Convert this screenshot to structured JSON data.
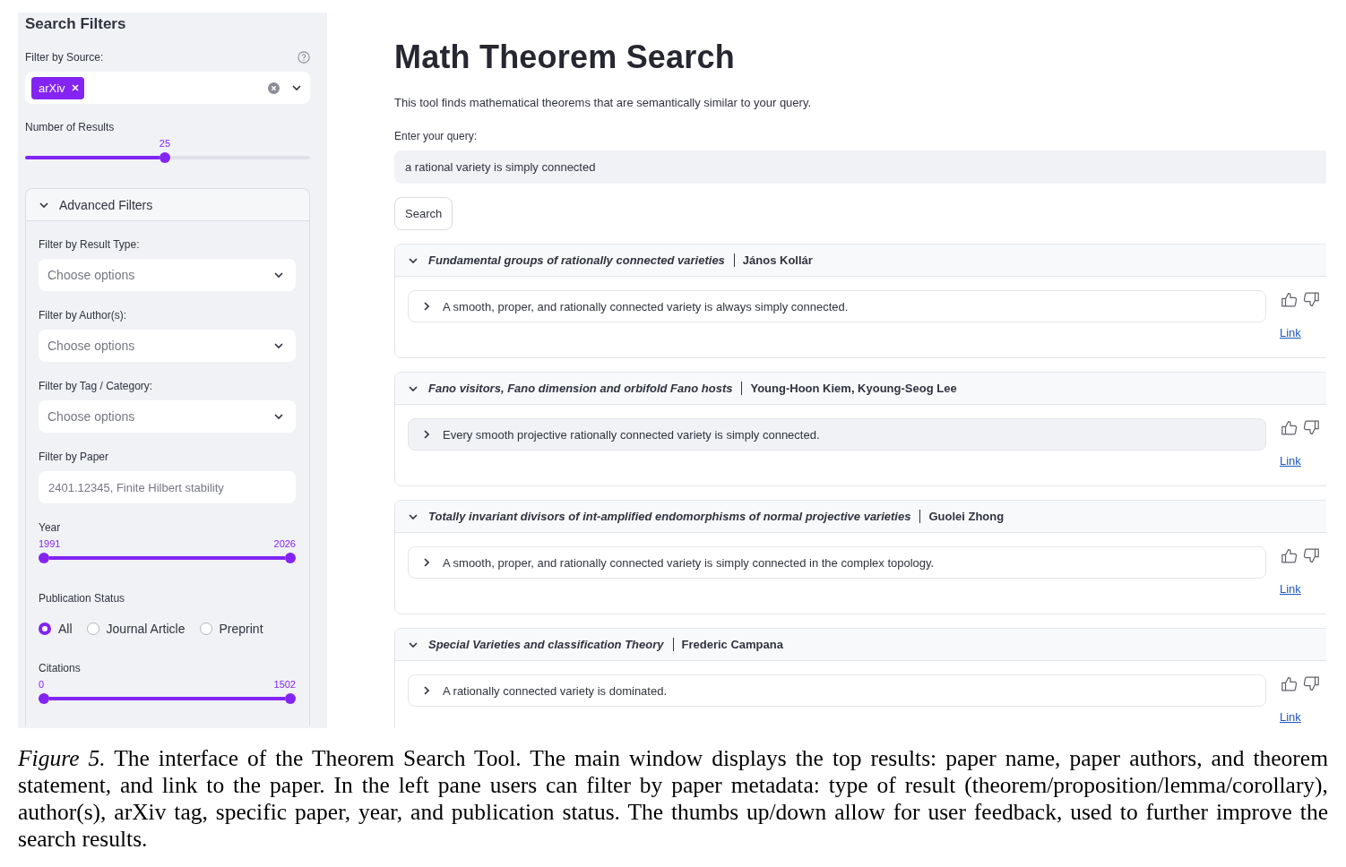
{
  "sidebar": {
    "title": "Search Filters",
    "source_filter": {
      "label": "Filter by Source:",
      "tags": [
        "arXiv"
      ]
    },
    "number_of_results": {
      "label": "Number of Results",
      "value": "25",
      "level": 0.49
    },
    "advanced_filters": {
      "title": "Advanced Filters",
      "expanded": true,
      "selects": [
        {
          "label": "Filter by Result Type:",
          "placeholder": "Choose options"
        },
        {
          "label": "Filter by Author(s):",
          "placeholder": "Choose options"
        },
        {
          "label": "Filter by Tag / Category:",
          "placeholder": "Choose options"
        }
      ],
      "paper_filter": {
        "label": "Filter by Paper",
        "placeholder": "2401.12345, Finite Hilbert stability"
      },
      "year": {
        "label": "Year",
        "low_value": "1991",
        "high_value": "2026",
        "level": 1
      },
      "publication_status": {
        "label": "Publication Status",
        "options": [
          {
            "label": "All",
            "selected": true
          },
          {
            "label": "Journal Article",
            "selected": false
          },
          {
            "label": "Preprint",
            "selected": false
          }
        ]
      },
      "citations": {
        "label": "Citations",
        "low_value": "0",
        "high_value": "1502",
        "level": 1
      }
    }
  },
  "main": {
    "title": "Math Theorem Search",
    "description": "This tool finds mathematical theorems that are semantically similar to your query.",
    "query": {
      "label": "Enter your query:",
      "value": "a rational variety is simply connected"
    },
    "search_button": "Search",
    "results": [
      {
        "paper_title": "Fundamental groups of rationally connected varieties",
        "authors": "János Kollár",
        "expanded": true,
        "statement": {
          "text": "A smooth, proper, and rationally connected variety is always simply connected.",
          "expanded": false,
          "hovered": false
        },
        "link": "Link"
      },
      {
        "paper_title": "Fano visitors, Fano dimension and orbifold Fano hosts",
        "authors": "Young-Hoon Kiem, Kyoung-Seog Lee",
        "expanded": true,
        "statement": {
          "text": "Every smooth projective rationally connected variety is simply connected.",
          "expanded": false,
          "hovered": true
        },
        "link": "Link"
      },
      {
        "paper_title": "Totally invariant divisors of int-amplified endomorphisms of normal projective varieties",
        "authors": "Guolei Zhong",
        "expanded": true,
        "statement": {
          "text": "A smooth, proper, and rationally connected variety is simply connected in the complex topology.",
          "expanded": false,
          "hovered": false
        },
        "link": "Link"
      },
      {
        "paper_title": "Special Varieties and classification Theory",
        "authors": "Frederic Campana",
        "expanded": true,
        "statement": {
          "text": "A rationally connected variety is dominated.",
          "expanded": false,
          "hovered": false
        },
        "link": "Link"
      }
    ]
  },
  "caption": "*Figure 5.* The interface of the Theorem Search Tool. The main window displays the top results: paper name, paper authors, and theorem statement, and link to the paper. In the left pane users can filter by paper metadata: type of result (theorem/proposition/lemma/corollary), author(s), arXiv tag, specific paper, year, and publication status. The thumbs up/down allow for user feedback, used to further improve the search results."
}
